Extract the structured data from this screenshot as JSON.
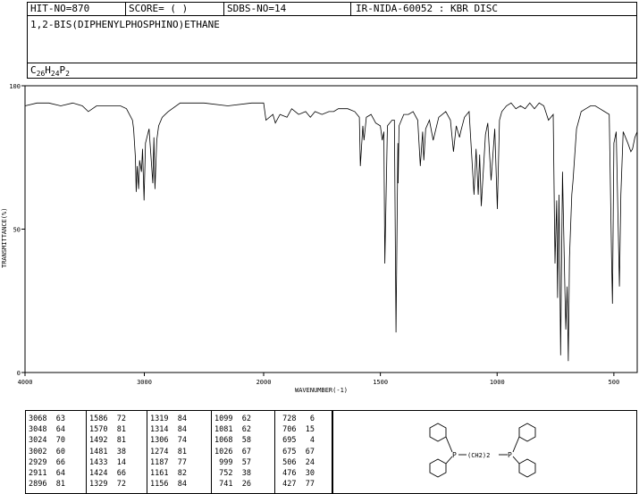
{
  "header": {
    "hit_no": "HIT-NO=870",
    "score": "SCORE=  (   )",
    "sdbs_no": "SDBS-NO=14",
    "ir_info": "IR-NIDA-60052 : KBR DISC",
    "compound_name": "1,2-BIS(DIPHENYLPHOSPHINO)ETHANE",
    "formula": {
      "c": "C",
      "c_n": "26",
      "h": "H",
      "h_n": "24",
      "p": "P",
      "p_n": "2"
    }
  },
  "chart_data": {
    "type": "line",
    "title": "",
    "xlabel": "WAVENUMBER(-1)",
    "ylabel": "TRANSMITTANCE(%)",
    "xlim": [
      4000,
      400
    ],
    "ylim": [
      0,
      100
    ],
    "x_ticks": [
      "4000",
      "3000",
      "2000",
      "1500",
      "1000",
      "500"
    ],
    "y_ticks": [
      "100",
      "50",
      "0"
    ],
    "series": [
      {
        "x": [
          4000,
          3900,
          3800,
          3700,
          3600,
          3520,
          3470,
          3400,
          3300,
          3200,
          3150,
          3100,
          3090,
          3075,
          3068,
          3060,
          3048,
          3040,
          3024,
          3015,
          3002,
          2990,
          2960,
          2929,
          2920,
          2911,
          2896,
          2880,
          2850,
          2800,
          2700,
          2500,
          2300,
          2100,
          2000,
          1990,
          1960,
          1950,
          1930,
          1900,
          1880,
          1850,
          1820,
          1800,
          1780,
          1750,
          1720,
          1700,
          1680,
          1640,
          1610,
          1590,
          1586,
          1575,
          1570,
          1560,
          1540,
          1520,
          1500,
          1492,
          1485,
          1481,
          1470,
          1450,
          1440,
          1433,
          1425,
          1424,
          1420,
          1400,
          1380,
          1360,
          1340,
          1329,
          1319,
          1314,
          1306,
          1290,
          1274,
          1250,
          1220,
          1200,
          1187,
          1175,
          1161,
          1156,
          1140,
          1120,
          1099,
          1090,
          1081,
          1075,
          1068,
          1050,
          1040,
          1026,
          1010,
          999,
          990,
          980,
          960,
          940,
          920,
          900,
          880,
          860,
          840,
          820,
          800,
          780,
          760,
          752,
          745,
          741,
          735,
          728,
          720,
          710,
          706,
          700,
          695,
          690,
          680,
          675,
          660,
          640,
          620,
          600,
          580,
          560,
          540,
          520,
          510,
          506,
          500,
          490,
          476,
          470,
          460,
          440,
          427,
          420,
          410,
          400
        ],
        "y": [
          93,
          94,
          94,
          93,
          94,
          93,
          91,
          93,
          93,
          93,
          92,
          88,
          85,
          75,
          63,
          72,
          64,
          74,
          70,
          78,
          60,
          80,
          85,
          66,
          82,
          64,
          81,
          86,
          89,
          91,
          94,
          94,
          93,
          94,
          94,
          88,
          90,
          87,
          90,
          89,
          92,
          90,
          91,
          89,
          91,
          90,
          91,
          91,
          92,
          92,
          91,
          89,
          72,
          86,
          81,
          89,
          90,
          87,
          86,
          81,
          84,
          38,
          86,
          88,
          88,
          14,
          80,
          66,
          86,
          90,
          90,
          91,
          88,
          72,
          84,
          74,
          85,
          88,
          81,
          89,
          91,
          88,
          77,
          86,
          82,
          84,
          89,
          91,
          62,
          78,
          62,
          76,
          58,
          83,
          87,
          67,
          85,
          57,
          88,
          91,
          93,
          94,
          92,
          93,
          92,
          94,
          92,
          94,
          93,
          88,
          90,
          38,
          60,
          26,
          62,
          6,
          70,
          30,
          15,
          30,
          4,
          40,
          62,
          67,
          85,
          91,
          92,
          93,
          93,
          92,
          91,
          90,
          40,
          24,
          80,
          84,
          30,
          62,
          84,
          80,
          77,
          78,
          82,
          84
        ]
      }
    ]
  },
  "peak_table": {
    "columns": [
      {
        "wavenumbers": [
          "3068",
          "3048",
          "3024",
          "3002",
          "2929",
          "2911",
          "2896"
        ],
        "intensities": [
          "63",
          "64",
          "70",
          "60",
          "66",
          "64",
          "81"
        ]
      },
      {
        "wavenumbers": [
          "1586",
          "1570",
          "1492",
          "1481",
          "1433",
          "1424",
          "1329"
        ],
        "intensities": [
          "72",
          "81",
          "81",
          "38",
          "14",
          "66",
          "72"
        ]
      },
      {
        "wavenumbers": [
          "1319",
          "1314",
          "1306",
          "1274",
          "1187",
          "1161",
          "1156"
        ],
        "intensities": [
          "84",
          "84",
          "74",
          "81",
          "77",
          "82",
          "84"
        ]
      },
      {
        "wavenumbers": [
          "1099",
          "1081",
          "1068",
          "1026",
          "999",
          "752",
          "741"
        ],
        "intensities": [
          "62",
          "62",
          "58",
          "67",
          "57",
          "38",
          "26"
        ]
      },
      {
        "wavenumbers": [
          "728",
          "706",
          "695",
          "675",
          "506",
          "476",
          "427"
        ],
        "intensities": [
          "6",
          "15",
          "4",
          "67",
          "24",
          "30",
          "77"
        ]
      }
    ]
  },
  "structure": {
    "p_left": "P",
    "p_right": "P",
    "bridge": "(CH2)2"
  }
}
